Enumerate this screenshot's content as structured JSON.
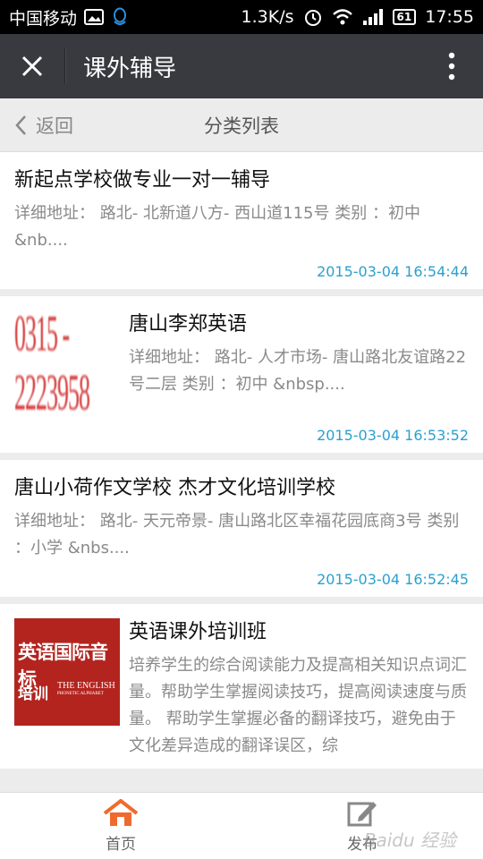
{
  "status_bar": {
    "carrier": "中国移动",
    "speed": "1.3K/s",
    "battery": "61",
    "time": "17:55"
  },
  "header": {
    "title": "课外辅导"
  },
  "subnav": {
    "back_label": "返回",
    "title": "分类列表"
  },
  "items": [
    {
      "title": "新起点学校做专业一对一辅导",
      "desc": "详细地址： 路北- 北新道八方- 西山道115号 类别 ：初中 &nb....",
      "time": "2015-03-04 16:54:44"
    },
    {
      "title": "唐山李郑英语",
      "desc": "详细地址： 路北- 人才市场- 唐山路北友谊路22号二层 类别 ：初中 &nbsp....",
      "time": "2015-03-04 16:53:52",
      "thumb_text": "0315 - 2223958"
    },
    {
      "title": "唐山小荷作文学校 杰才文化培训学校",
      "desc": "详细地址： 路北- 天元帝景- 唐山路北区幸福花园底商3号 类别 ：小学 &nbs....",
      "time": "2015-03-04 16:52:45"
    },
    {
      "title": "英语课外培训班",
      "desc": "培养学生的综合阅读能力及提高相关知识点词汇量。帮助学生掌握阅读技巧，提高阅读速度与质量。 帮助学生掌握必备的翻译技巧，避免由于文化差异造成的翻译误区，综",
      "thumb_line1": "英语国际音标",
      "thumb_line2": "培训",
      "thumb_line3": "THE ENGLISH",
      "thumb_line4": "PHONETIC ALPHABET"
    }
  ],
  "tabs": {
    "home": "首页",
    "publish": "发布"
  },
  "watermark": "Baidu 经验",
  "colors": {
    "accent": "#f06a2d",
    "time": "#2aa0cf",
    "titlebar": "#393a3f"
  }
}
